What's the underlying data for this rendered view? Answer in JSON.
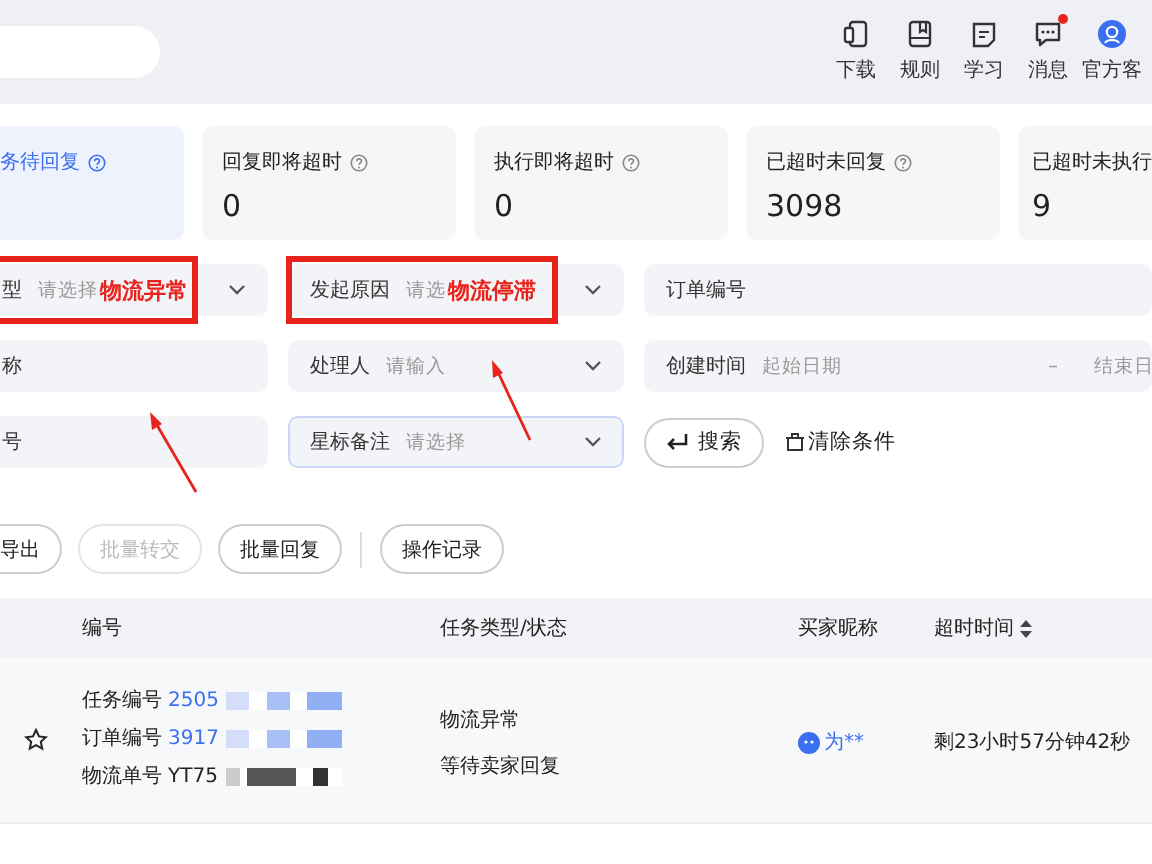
{
  "top_bar": {
    "nav_items": [
      {
        "kind": "download",
        "label": "下载",
        "has_dot": false
      },
      {
        "kind": "rules",
        "label": "规则",
        "has_dot": false
      },
      {
        "kind": "learn",
        "label": "学习",
        "has_dot": false
      },
      {
        "kind": "message",
        "label": "消息",
        "has_dot": true
      },
      {
        "kind": "service",
        "label": "官方客",
        "has_dot": false
      }
    ]
  },
  "stats": [
    {
      "label": "务待回复",
      "selected": true
    },
    {
      "label": "回复即将超时",
      "value": "0",
      "selected": false
    },
    {
      "label": "执行即将超时",
      "value": "0",
      "selected": false
    },
    {
      "label": "已超时未回复",
      "value": "3098",
      "selected": false
    },
    {
      "label": "已超时未执行",
      "value": "9",
      "selected": false
    }
  ],
  "filters": [
    [
      {
        "kind": "select",
        "label": "型",
        "placeholder": "请选择",
        "annotation": "物流异常",
        "focused": false
      },
      {
        "kind": "select",
        "label": "发起原因",
        "placeholder": "请选",
        "annotation": "物流停滞",
        "focused": false
      },
      {
        "kind": "input",
        "label": "订单编号",
        "focused": false
      }
    ],
    [
      {
        "kind": "input",
        "label": "称",
        "focused": false
      },
      {
        "kind": "select",
        "label": "处理人",
        "placeholder": "请输入",
        "focused": false
      },
      {
        "kind": "date",
        "label": "创建时间",
        "placeholder": "起始日期",
        "separator": "–",
        "placeholder_end": "结束日",
        "focused": false
      }
    ],
    [
      {
        "kind": "input",
        "label": "号",
        "focused": false
      },
      {
        "kind": "select",
        "label": "星标备注",
        "placeholder": "请选择",
        "focused": true
      }
    ]
  ],
  "search_button": "搜索",
  "clear_button": "清除条件",
  "actions": [
    {
      "label": "导出",
      "disabled": false
    },
    {
      "label": "批量转交",
      "disabled": true
    },
    {
      "label": "批量回复",
      "disabled": false
    },
    {
      "label": "操作记录",
      "disabled": false
    }
  ],
  "table": {
    "columns": [
      "编号",
      "任务类型/状态",
      "买家昵称",
      "超时时间"
    ],
    "rows": [
      {
        "starred": false,
        "ids": [
          {
            "label": "任务编号",
            "value": "2505",
            "link": true
          },
          {
            "label": "订单编号",
            "value": "3917",
            "link": true
          },
          {
            "label": "物流单号",
            "value": "YT75",
            "link": false
          }
        ],
        "type": "物流异常",
        "status": "等待卖家回复",
        "buyer": "为**",
        "timeout": "剩23小时57分钟42秒"
      }
    ]
  }
}
